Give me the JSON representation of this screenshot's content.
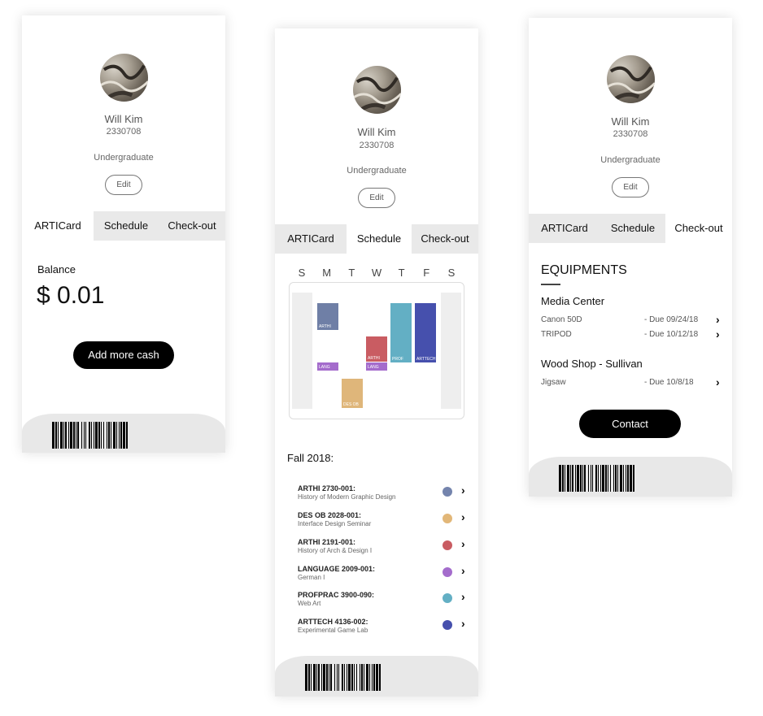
{
  "profile": {
    "name": "Will Kim",
    "id": "2330708",
    "level": "Undergraduate",
    "edit_label": "Edit"
  },
  "tabs": [
    "ARTICard",
    "Schedule",
    "Check-out"
  ],
  "articard": {
    "balance_label": "Balance",
    "balance_value": "$ 0.01",
    "add_cash_label": "Add more cash"
  },
  "schedule": {
    "days": [
      "S",
      "M",
      "T",
      "W",
      "T",
      "F",
      "S"
    ],
    "events": [
      {
        "label": "ARTHI",
        "color": "#6f7fa6"
      },
      {
        "label": "LANG",
        "color": "#a46ccc"
      },
      {
        "label": "DES OB",
        "color": "#dfb67a"
      },
      {
        "label": "LANG",
        "color": "#a46ccc"
      },
      {
        "label": "ARTHI",
        "color": "#c95c62"
      },
      {
        "label": "PROF",
        "color": "#63afc4"
      },
      {
        "label": "ARTTECH",
        "color": "#4650ad"
      }
    ],
    "term": "Fall 2018:",
    "courses": [
      {
        "code": "ARTHI 2730-001:",
        "title": "History of Modern Graphic Design",
        "color": "#7484ad"
      },
      {
        "code": "DES OB 2028-001:",
        "title": "Interface Design Seminar",
        "color": "#e2b778"
      },
      {
        "code": "ARTHI 2191-001:",
        "title": "History of Arch & Design I",
        "color": "#c95c62"
      },
      {
        "code": "LANGUAGE 2009-001:",
        "title": "German I",
        "color": "#a46ccc"
      },
      {
        "code": "PROFPRAC 3900-090:",
        "title": "Web Art",
        "color": "#63afc4"
      },
      {
        "code": "ARTTECH 4136-002:",
        "title": "Experimental Game Lab",
        "color": "#4650ad"
      }
    ]
  },
  "checkout": {
    "title": "EQUIPMENTS",
    "sections": [
      {
        "name": "Media Center",
        "items": [
          {
            "name": "Canon 50D",
            "due": "- Due 09/24/18"
          },
          {
            "name": "TRIPOD",
            "due": "- Due 10/12/18"
          }
        ]
      },
      {
        "name": "Wood Shop - Sullivan",
        "items": [
          {
            "name": "Jigsaw",
            "due": "- Due 10/8/18"
          }
        ]
      }
    ],
    "contact_label": "Contact"
  },
  "icons": {
    "chevron": "chevron-right-icon",
    "barcode": "barcode-icon",
    "avatar": "profile-photo"
  }
}
